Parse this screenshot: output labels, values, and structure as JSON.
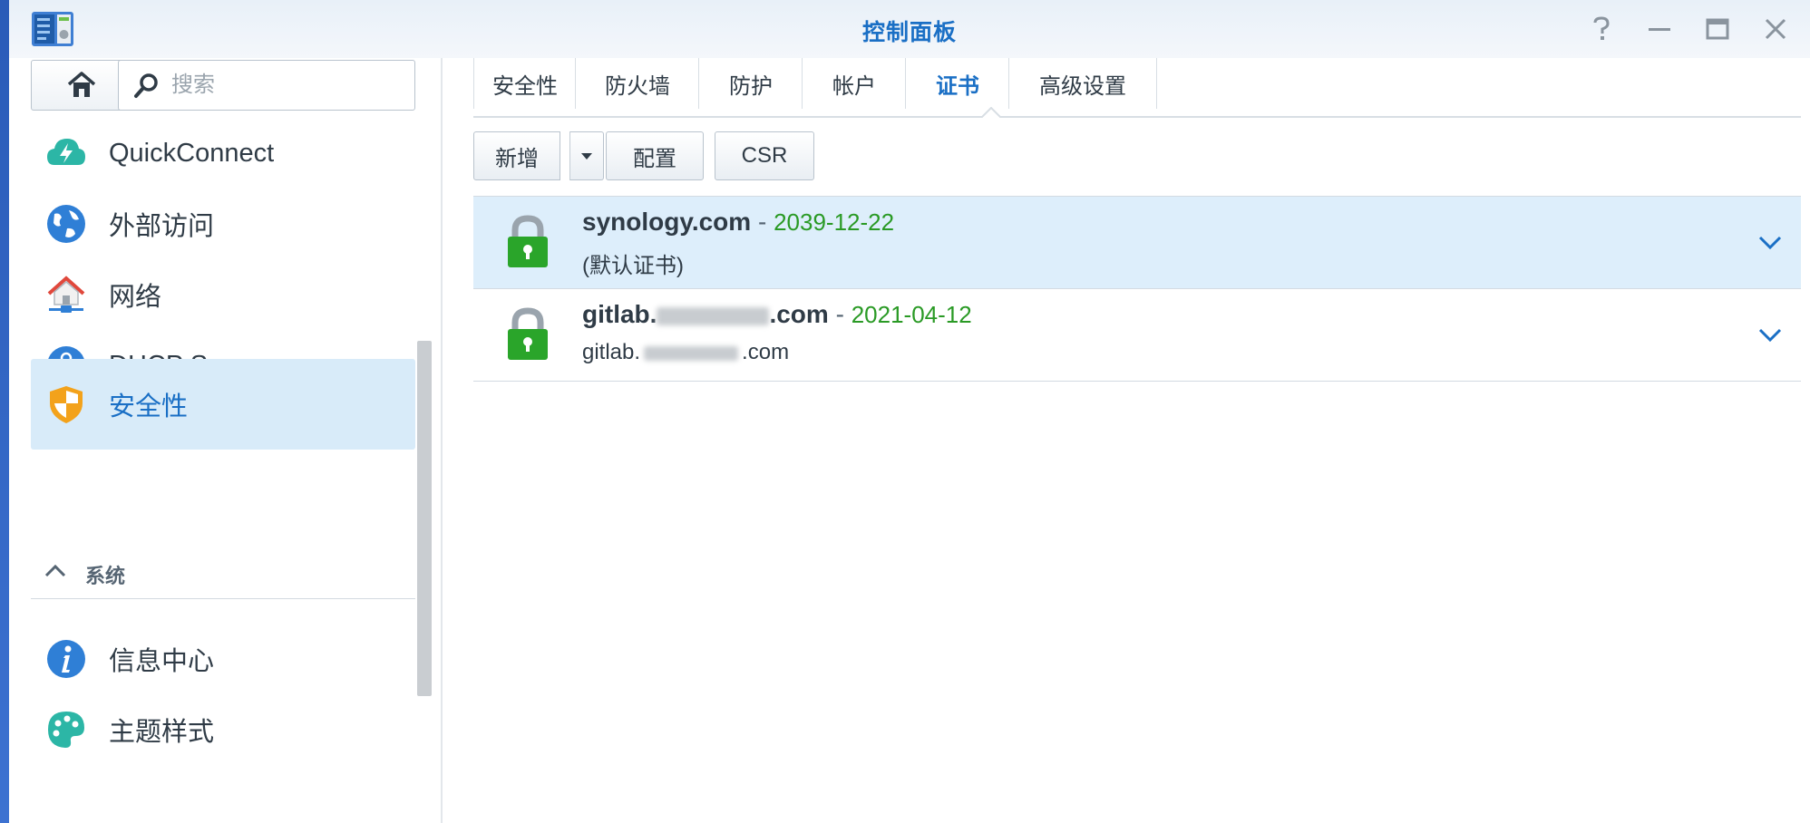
{
  "window": {
    "title": "控制面板"
  },
  "sidebar": {
    "search_placeholder": "搜索",
    "items": [
      {
        "label": "QuickConnect",
        "icon": "quickconnect-cloud-icon"
      },
      {
        "label": "外部访问",
        "icon": "globe-icon"
      },
      {
        "label": "网络",
        "icon": "network-house-icon"
      },
      {
        "label": "DHCP Server",
        "icon": "dhcp-node-icon"
      },
      {
        "label": "安全性",
        "icon": "shield-icon",
        "active": true
      }
    ],
    "section": {
      "label": "系统",
      "icon": "chevron-up-icon"
    },
    "system_items": [
      {
        "label": "信息中心",
        "icon": "info-icon"
      },
      {
        "label": "主题样式",
        "icon": "palette-icon"
      }
    ]
  },
  "tabs": [
    {
      "label": "安全性"
    },
    {
      "label": "防火墙"
    },
    {
      "label": "防护"
    },
    {
      "label": "帐户"
    },
    {
      "label": "证书",
      "active": true
    },
    {
      "label": "高级设置"
    }
  ],
  "toolbar": {
    "add_label": "新增",
    "configure_label": "配置",
    "csr_label": "CSR"
  },
  "certificates": [
    {
      "name": "synology.com",
      "separator": " - ",
      "expiry": "2039-12-22",
      "subtitle": "(默认证书)",
      "selected": true
    },
    {
      "name_prefix": "gitlab.",
      "name_suffix": ".com",
      "separator": " - ",
      "expiry": "2021-04-12",
      "subtitle_prefix": "gitlab.",
      "subtitle_suffix": ".com",
      "selected": false
    }
  ],
  "colors": {
    "accent": "#1a6fc5",
    "selected_bg": "#ddeefb",
    "expiry_green": "#2a9a25",
    "lock_green": "#2aa52a"
  }
}
